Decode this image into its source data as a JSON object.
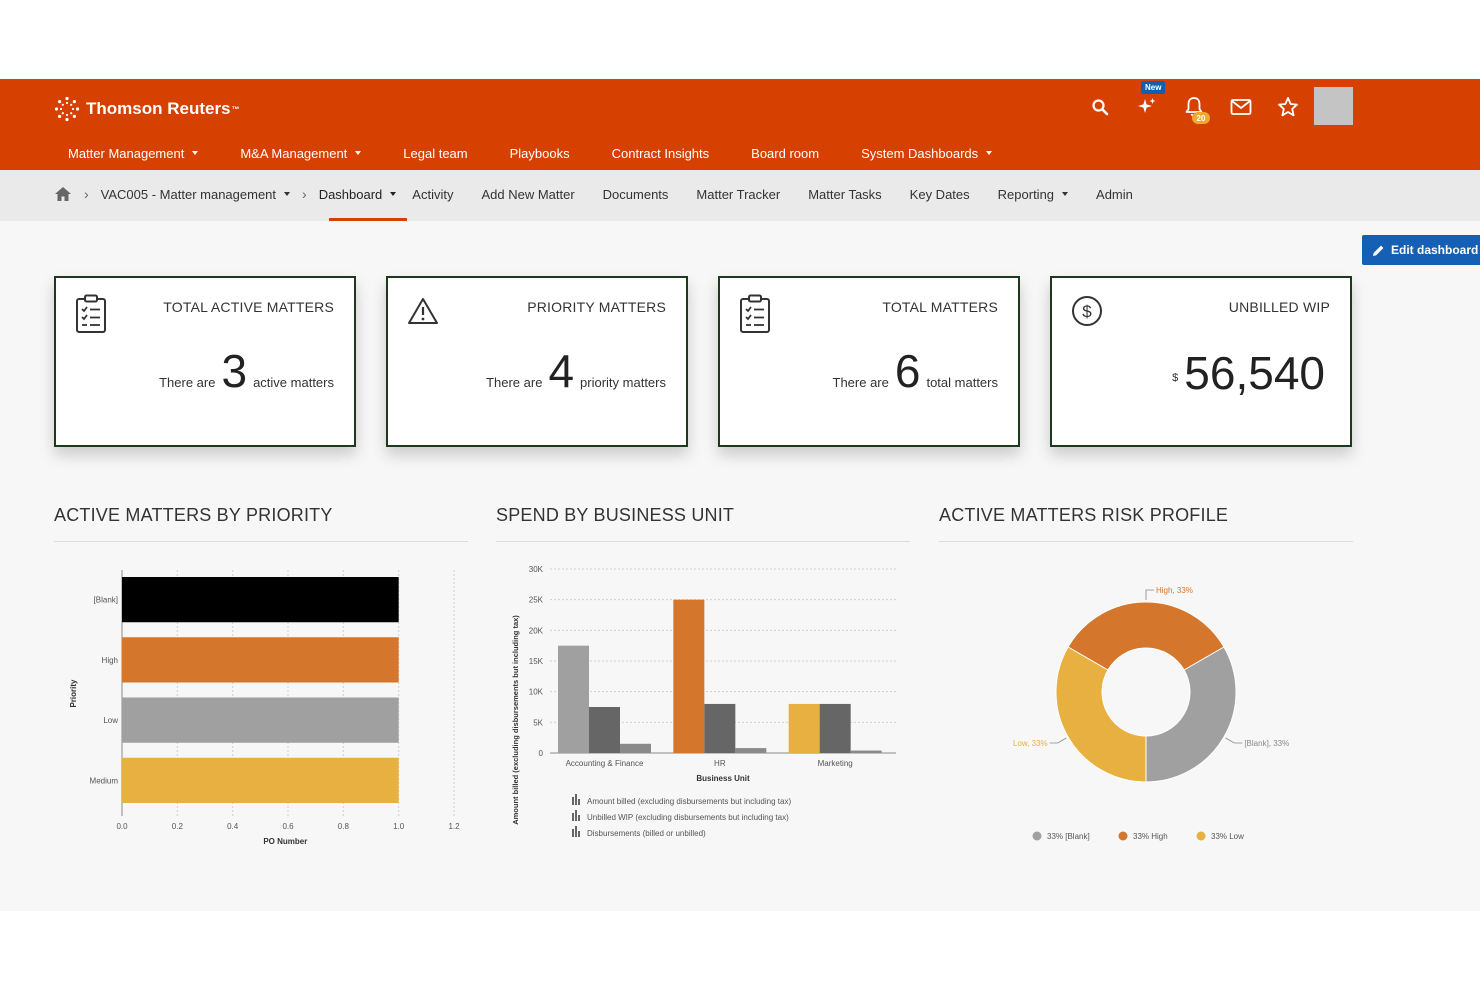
{
  "brand": {
    "name": "Thomson Reuters",
    "tm": "™"
  },
  "nav": [
    {
      "label": "Matter Management",
      "dropdown": true
    },
    {
      "label": "M&A Management",
      "dropdown": true
    },
    {
      "label": "Legal team",
      "dropdown": false
    },
    {
      "label": "Playbooks",
      "dropdown": false
    },
    {
      "label": "Contract Insights",
      "dropdown": false
    },
    {
      "label": "Board room",
      "dropdown": false
    },
    {
      "label": "System Dashboards",
      "dropdown": true
    }
  ],
  "header_icons": {
    "new_badge": "New",
    "notification_count": "20"
  },
  "breadcrumb": {
    "matter": "VAC005 - Matter management"
  },
  "tabs": [
    {
      "label": "Dashboard",
      "active": true,
      "dropdown": true
    },
    {
      "label": "Activity"
    },
    {
      "label": "Add New Matter"
    },
    {
      "label": "Documents"
    },
    {
      "label": "Matter Tracker"
    },
    {
      "label": "Matter Tasks"
    },
    {
      "label": "Key Dates"
    },
    {
      "label": "Reporting",
      "dropdown": true
    },
    {
      "label": "Admin"
    }
  ],
  "edit_dashboard": "Edit dashboard",
  "cards": [
    {
      "title": "TOTAL ACTIVE MATTERS",
      "prefix": "There are",
      "value": "3",
      "suffix": "active matters"
    },
    {
      "title": "PRIORITY MATTERS",
      "prefix": "There are",
      "value": "4",
      "suffix": "priority matters"
    },
    {
      "title": "TOTAL MATTERS",
      "prefix": "There are",
      "value": "6",
      "suffix": "total matters"
    },
    {
      "title": "UNBILLED WIP",
      "currency": "$",
      "value": "56,540"
    }
  ],
  "sections": {
    "priority": "ACTIVE MATTERS BY PRIORITY",
    "spend": "SPEND BY BUSINESS UNIT",
    "risk": "ACTIVE MATTERS RISK PROFILE"
  },
  "chart_data": [
    {
      "type": "bar",
      "orientation": "horizontal",
      "categories": [
        "[Blank]",
        "High",
        "Low",
        "Medium"
      ],
      "values": [
        1.0,
        1.0,
        1.0,
        1.0
      ],
      "colors": [
        "#000000",
        "#d4762c",
        "#a0a0a0",
        "#e8b040"
      ],
      "xlabel": "PO Number",
      "ylabel": "Priority",
      "xlim": [
        0,
        1.2
      ],
      "xticks": [
        "0.0",
        "0.2",
        "0.4",
        "0.6",
        "0.8",
        "1.0",
        "1.2"
      ]
    },
    {
      "type": "bar",
      "categories": [
        "Accounting & Finance",
        "HR",
        "Marketing"
      ],
      "series": [
        {
          "name": "Amount billed (excluding disbursements but including tax)",
          "values": [
            17500,
            25000,
            8000
          ],
          "color": "#a0a0a0"
        },
        {
          "name": "Unbilled WIP (excluding disbursements but including tax)",
          "values": [
            7500,
            8000,
            8000
          ],
          "color": "#666666"
        },
        {
          "name": "Disbursements (billed or unbilled)",
          "values": [
            1500,
            800,
            400
          ],
          "color": "#8a8a8a"
        }
      ],
      "highlight_colors": [
        "",
        "#d4762c",
        "#e8b040"
      ],
      "xlabel": "Business Unit",
      "ylabel": "Amount billed (excluding disbursements but including tax)",
      "ylim": [
        0,
        30000
      ],
      "yticks": [
        "0",
        "5K",
        "10K",
        "15K",
        "20K",
        "25K",
        "30K"
      ]
    },
    {
      "type": "pie",
      "donut": true,
      "slices": [
        {
          "label": "High, 33%",
          "value": 33,
          "color": "#d4762c"
        },
        {
          "label": "[Blank], 33%",
          "value": 33,
          "color": "#a0a0a0"
        },
        {
          "label": "Low, 33%",
          "value": 33,
          "color": "#e8b040"
        }
      ],
      "legend": [
        {
          "label": "33% [Blank]",
          "color": "#a0a0a0"
        },
        {
          "label": "33% High",
          "color": "#d4762c"
        },
        {
          "label": "33% Low",
          "color": "#e8b040"
        }
      ]
    }
  ]
}
